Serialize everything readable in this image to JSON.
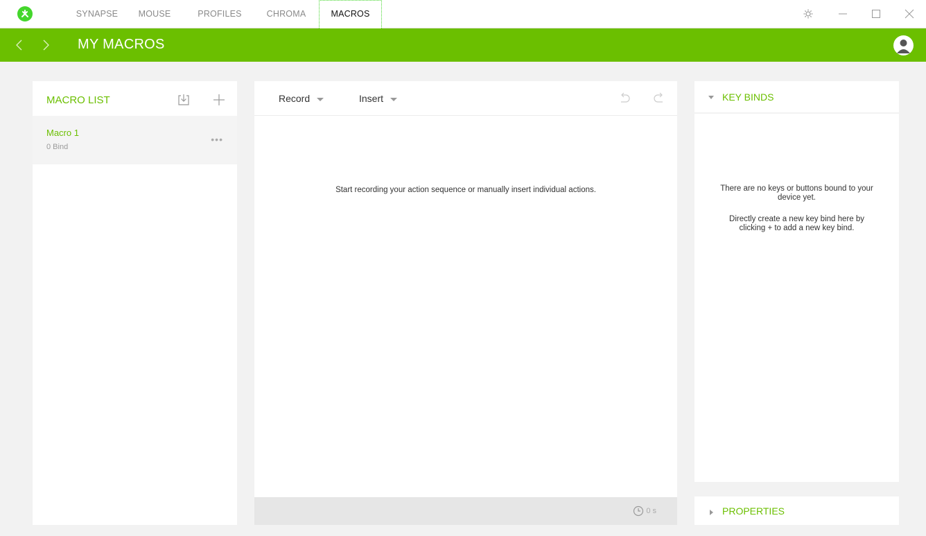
{
  "nav": {
    "tabs": [
      "SYNAPSE",
      "MOUSE",
      "PROFILES",
      "CHROMA",
      "MACROS"
    ],
    "active_tab": "MACROS"
  },
  "header": {
    "title": "MY MACROS"
  },
  "macro_list": {
    "title": "MACRO LIST",
    "items": [
      {
        "name": "Macro 1",
        "binds": "0 Bind"
      }
    ]
  },
  "editor": {
    "record_label": "Record",
    "insert_label": "Insert",
    "empty_message": "Start recording your action sequence or manually insert individual actions.",
    "duration": "0 s"
  },
  "key_binds": {
    "title": "KEY BINDS",
    "message_1": "There are no keys or buttons bound to your device yet.",
    "message_2": "Directly create a new key bind here by clicking + to add a new key bind."
  },
  "properties": {
    "title": "PROPERTIES"
  },
  "colors": {
    "accent": "#6bbf00",
    "logo": "#44d62c"
  },
  "icons": [
    "razer-logo-icon",
    "settings-icon",
    "minimize-icon",
    "maximize-icon",
    "close-icon",
    "back-arrow-icon",
    "forward-arrow-icon",
    "avatar-icon",
    "import-icon",
    "add-icon",
    "undo-icon",
    "redo-icon",
    "clock-icon"
  ]
}
